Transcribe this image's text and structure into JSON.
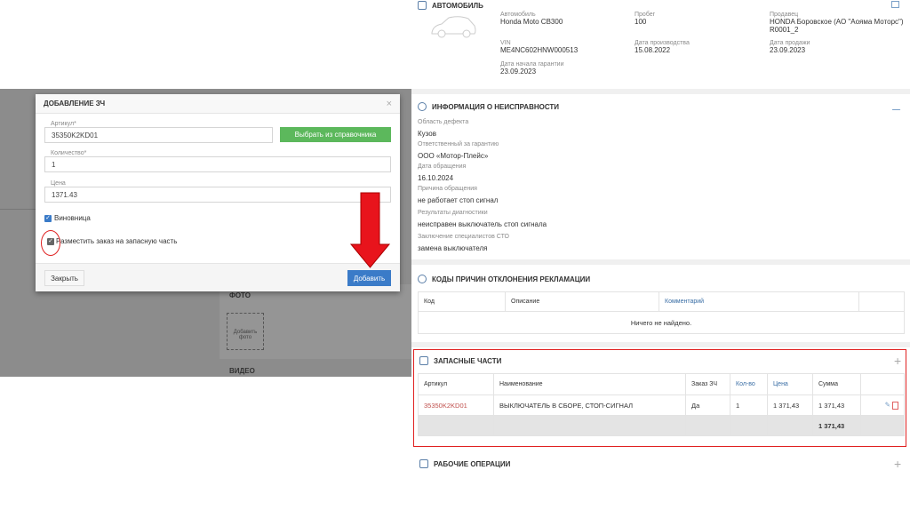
{
  "car": {
    "title": "АВТОМОБИЛЬ",
    "fields": [
      {
        "label": "Автомобиль",
        "value": "Honda Moto CB300"
      },
      {
        "label": "Пробег",
        "value": "100"
      },
      {
        "label": "Продавец",
        "value": "HONDA Боровское (АО \"Аояма Моторс\")",
        "value2": "R0001_2"
      },
      {
        "label": "VIN",
        "value": "ME4NC602HNW000513"
      },
      {
        "label": "Дата производства",
        "value": "15.08.2022"
      },
      {
        "label": "Дата продажи",
        "value": "23.09.2023"
      },
      {
        "label": "Дата начала гарантии",
        "value": "23.09.2023"
      }
    ]
  },
  "fault": {
    "title": "ИНФОРМАЦИЯ О НЕИСПРАВНОСТИ",
    "fields": [
      {
        "label": "Область дефекта",
        "value": "Кузов"
      },
      {
        "label": "Ответственный за гарантию",
        "value": "ООО «Мотор-Плейс»"
      },
      {
        "label": "Дата обращения",
        "value": "16.10.2024"
      },
      {
        "label": "Причина обращения",
        "value": "не работает стоп сигнал"
      },
      {
        "label": "Результаты диагностики",
        "value": "неисправен выключатель стоп сигнала"
      },
      {
        "label": "Заключение специалистов СТО",
        "value": "замена выключателя"
      }
    ]
  },
  "codes": {
    "title": "КОДЫ ПРИЧИН ОТКЛОНЕНИЯ РЕКЛАМАЦИИ",
    "columns": [
      "Код",
      "Описание",
      "Комментарий"
    ],
    "empty": "Ничего не найдено."
  },
  "parts": {
    "title": "ЗАПАСНЫЕ ЧАСТИ",
    "columns": [
      "Артикул",
      "Наименование",
      "Заказ ЗЧ",
      "Кол-во",
      "Цена",
      "Сумма"
    ],
    "rows": [
      {
        "article": "35350K2KD01",
        "name": "ВЫКЛЮЧАТЕЛЬ В СБОРЕ, СТОП-СИГНАЛ",
        "order": "Да",
        "qty": "1",
        "price": "1 371,43",
        "sum": "1 371,43"
      }
    ],
    "total": "1 371,43",
    "add": "+"
  },
  "ops": {
    "title": "РАБОЧИЕ ОПЕРАЦИИ",
    "add": "+"
  },
  "bg": {
    "photo": "ФОТО",
    "add_photo": "Добавить фото",
    "video": "ВИДЕО"
  },
  "modal": {
    "title": "ДОБАВЛЕНИЕ ЗЧ",
    "close": "×",
    "article_label": "Артикул*",
    "article_value": "35350K2KD01",
    "pick_button": "Выбрать из справочника",
    "qty_label": "Количество*",
    "qty_value": "1",
    "price_label": "Цена",
    "price_value": "1371.43",
    "culprit_label": "Виновница",
    "order_label": "Разместить заказ на запасную часть",
    "close_button": "Закрыть",
    "add_button": "Добавить"
  },
  "colors": {
    "accent": "#3a7bc8",
    "green": "#5cb85c",
    "red": "#e02020"
  }
}
